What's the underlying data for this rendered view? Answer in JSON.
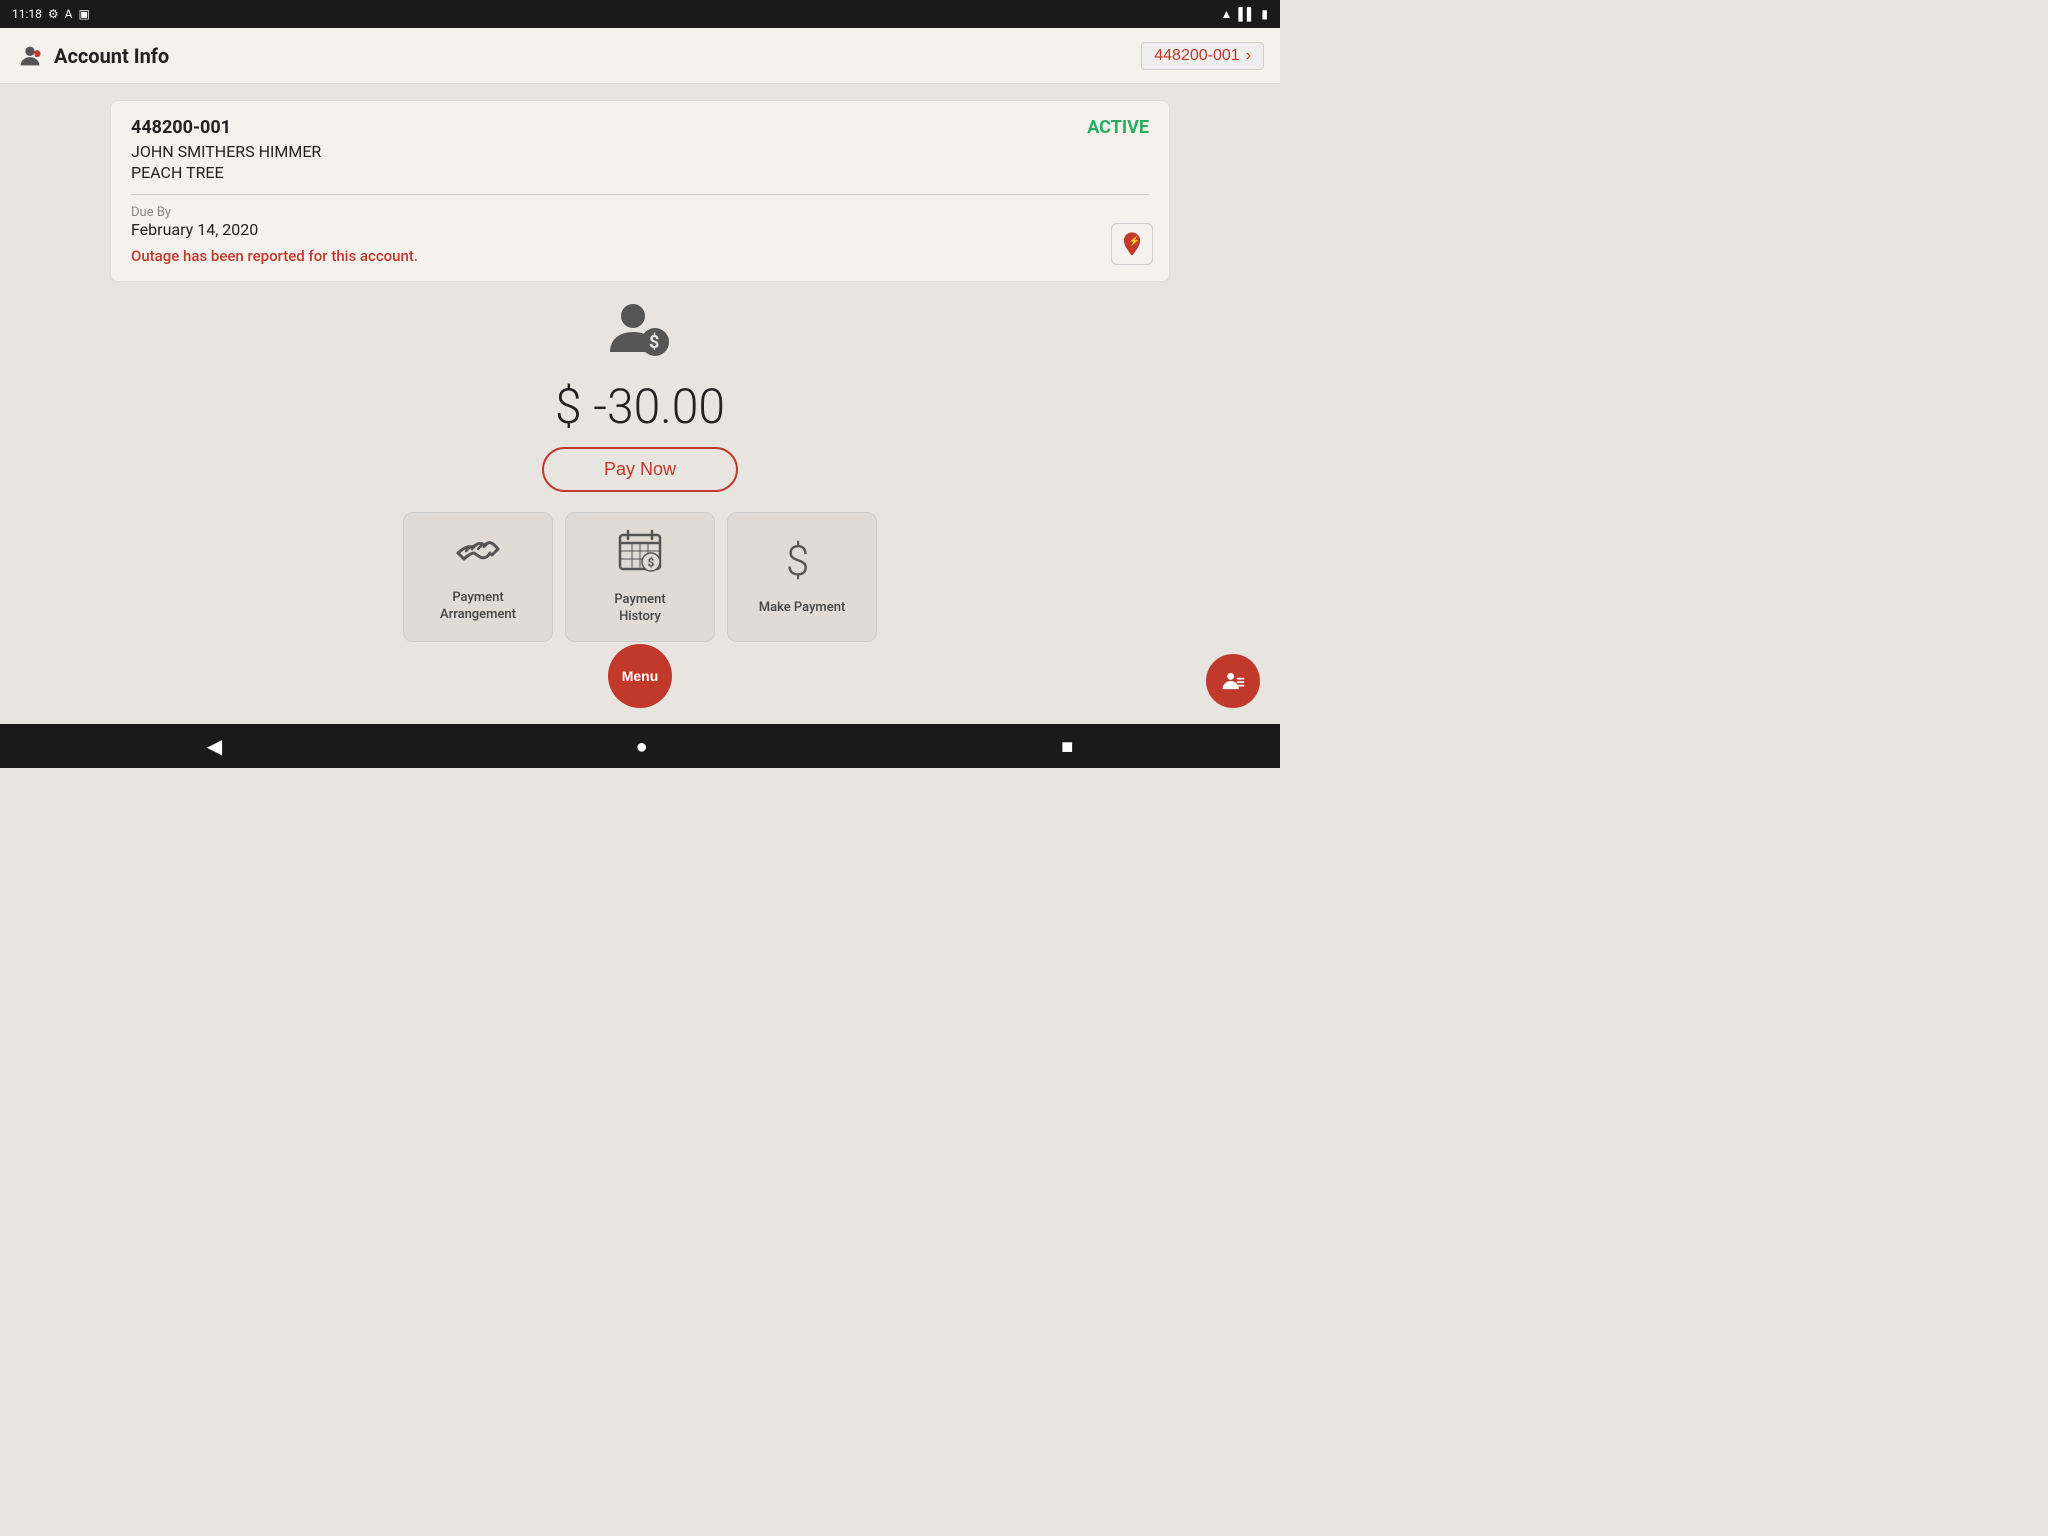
{
  "status_bar": {
    "time": "11:18",
    "icons": [
      "settings",
      "accessibility",
      "sim"
    ]
  },
  "app_bar": {
    "title": "Account Info",
    "account_number": "448200-001",
    "chevron": "›"
  },
  "account_card": {
    "account_number": "448200-001",
    "status": "ACTIVE",
    "name": "JOHN SMITHERS HIMMER",
    "location": "PEACH TREE",
    "due_label": "Due By",
    "due_date": "February 14, 2020",
    "outage_message": "Outage has been reported for this account."
  },
  "balance": {
    "amount": "$ -30.00",
    "pay_now_label": "Pay Now"
  },
  "action_tiles": [
    {
      "id": "payment-arrangement",
      "label": "Payment Arrangement",
      "icon": "handshake"
    },
    {
      "id": "payment-history",
      "label": "Payment History",
      "icon": "calendar-dollar"
    },
    {
      "id": "make-payment",
      "label": "Make Payment",
      "icon": "dollar-sign"
    }
  ],
  "dots": [
    {
      "active": true
    },
    {
      "active": false
    }
  ],
  "menu_label": "Menu",
  "nav": {
    "back": "◀",
    "home": "●",
    "recents": "■"
  }
}
